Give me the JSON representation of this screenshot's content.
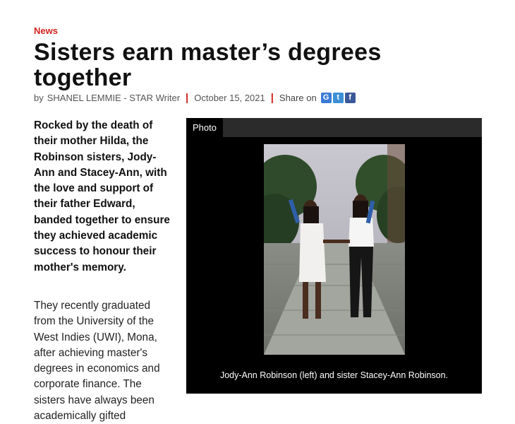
{
  "article": {
    "section": "News",
    "title": "Sisters earn master’s degrees together",
    "byline": {
      "by": "by",
      "author": "SHANEL LEMMIE - STAR Writer",
      "separator": "|",
      "date": "October 15, 2021",
      "share_label": "Share on",
      "share_buttons": [
        {
          "name": "google",
          "glyph": "G",
          "color": "#3b7bd8"
        },
        {
          "name": "twitter",
          "glyph": "t",
          "color": "#3d8fd6"
        },
        {
          "name": "facebook",
          "glyph": "f",
          "color": "#3b5998"
        }
      ]
    },
    "lead": "Rocked by the death of their mother Hilda, the Robinson sisters, Jody-Ann and Stacey-Ann, with the love and support of their father Edward, banded together to ensure they achieved academic success to honour their mother's memory.",
    "paragraph_1": "They recently graduated from the University of the West Indies (UWI), Mona, after achieving master's degrees in economics and corporate finance. The sisters have always been academically gifted",
    "photo": {
      "tab_label": "Photo",
      "caption": "Jody-Ann Robinson (left) and sister Stacey-Ann Robinson."
    }
  }
}
